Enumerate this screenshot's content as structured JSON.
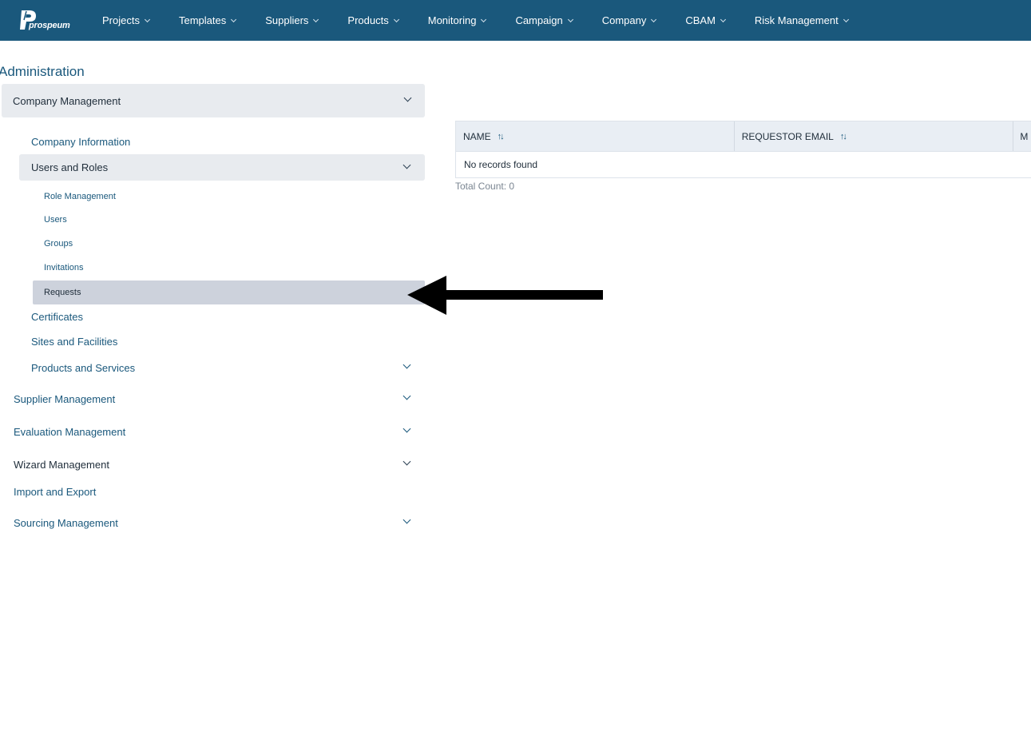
{
  "brand": {
    "logo_text": "prospeum"
  },
  "nav": {
    "items": [
      {
        "label": "Projects"
      },
      {
        "label": "Templates"
      },
      {
        "label": "Suppliers"
      },
      {
        "label": "Products"
      },
      {
        "label": "Monitoring"
      },
      {
        "label": "Campaign"
      },
      {
        "label": "Company"
      },
      {
        "label": "CBAM"
      },
      {
        "label": "Risk Management"
      }
    ]
  },
  "sidebar": {
    "title": "Administration",
    "company_management": {
      "label": "Company Management",
      "company_information": "Company Information",
      "users_and_roles": {
        "label": "Users and Roles",
        "items": [
          {
            "label": "Role Management"
          },
          {
            "label": "Users"
          },
          {
            "label": "Groups"
          },
          {
            "label": "Invitations"
          },
          {
            "label": "Requests"
          }
        ],
        "active": "Requests"
      },
      "certificates": "Certificates",
      "sites_and_facilities": "Sites and Facilities",
      "products_and_services": "Products and Services"
    },
    "sections": {
      "supplier_management": "Supplier Management",
      "evaluation_management": "Evaluation Management",
      "wizard_management": "Wizard Management",
      "import_and_export": "Import and Export",
      "sourcing_management": "Sourcing Management"
    }
  },
  "table": {
    "columns": [
      "NAME",
      "REQUESTOR EMAIL",
      "M"
    ],
    "empty_message": "No records found",
    "total_count_label": "Total Count: 0"
  },
  "colors": {
    "nav_bg": "#1a587c",
    "link": "#1a587c",
    "panel_bg": "#e8ebef",
    "active_bg": "#cdd2dc"
  },
  "icons": {
    "sort": "sort-icon",
    "chevron": "chevron-down-icon",
    "annotation": "arrow-left-icon"
  }
}
